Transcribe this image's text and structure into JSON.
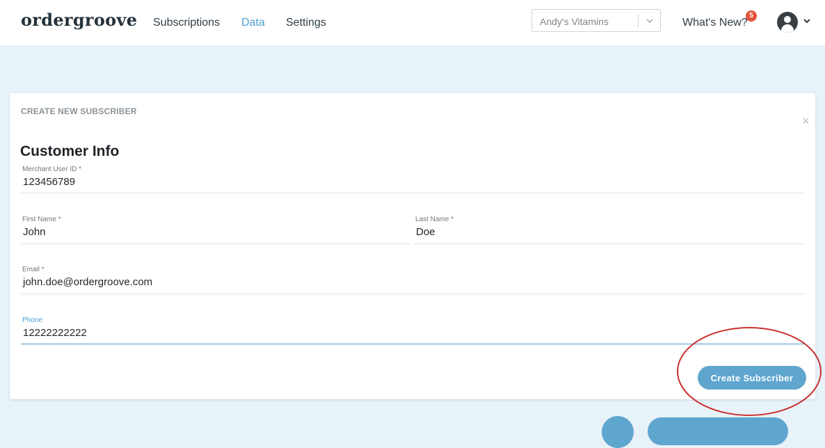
{
  "header": {
    "logo": "ordergroove",
    "nav": [
      "Subscriptions",
      "Data",
      "Settings"
    ],
    "active_nav": "Data",
    "store_selector": "Andy's Vitamins",
    "whats_new": "What's New?",
    "notifications_count": "5"
  },
  "panel": {
    "title": "CREATE NEW SUBSCRIBER",
    "close_glyph": "×",
    "section_title": "Customer Info",
    "fields": {
      "merchant_user_id": {
        "label": "Merchant User ID *",
        "value": "123456789"
      },
      "first_name": {
        "label": "First Name *",
        "value": "John"
      },
      "last_name": {
        "label": "Last Name *",
        "value": "Doe"
      },
      "email": {
        "label": "Email *",
        "value": "john.doe@ordergroove.com"
      },
      "phone": {
        "label": "Phone",
        "value": "12222222222"
      }
    },
    "submit_label": "Create Subscriber"
  },
  "colors": {
    "accent": "#4a9fd0",
    "button": "#5fa6cf",
    "badge": "#e5533c",
    "annotation_ring": "#c9302c",
    "page_background": "#e8f2f9"
  },
  "icons": [
    "chevron-down-icon",
    "notification-badge",
    "user-avatar-icon",
    "close-icon"
  ]
}
